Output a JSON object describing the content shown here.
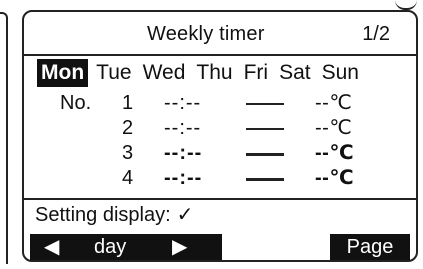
{
  "header": {
    "title": "Weekly timer",
    "page": "1/2"
  },
  "days": [
    "Mon",
    "Tue",
    "Wed",
    "Thu",
    "Fri",
    "Sat",
    "Sun"
  ],
  "selected_day": "Mon",
  "schedule": {
    "label": "No.",
    "rows": [
      {
        "number": "1",
        "time": "--:--",
        "temp": "--℃"
      },
      {
        "number": "2",
        "time": "--:--",
        "temp": "--℃"
      },
      {
        "number": "3",
        "time": "--:--",
        "temp": "--℃"
      },
      {
        "number": "4",
        "time": "--:--",
        "temp": "--℃"
      }
    ]
  },
  "setting": {
    "label": "Setting display:",
    "mark": "✓"
  },
  "softkeys": {
    "day": {
      "left_arrow": "◀",
      "label": "day",
      "right_arrow": "▶"
    },
    "page": {
      "label": "Page"
    }
  }
}
